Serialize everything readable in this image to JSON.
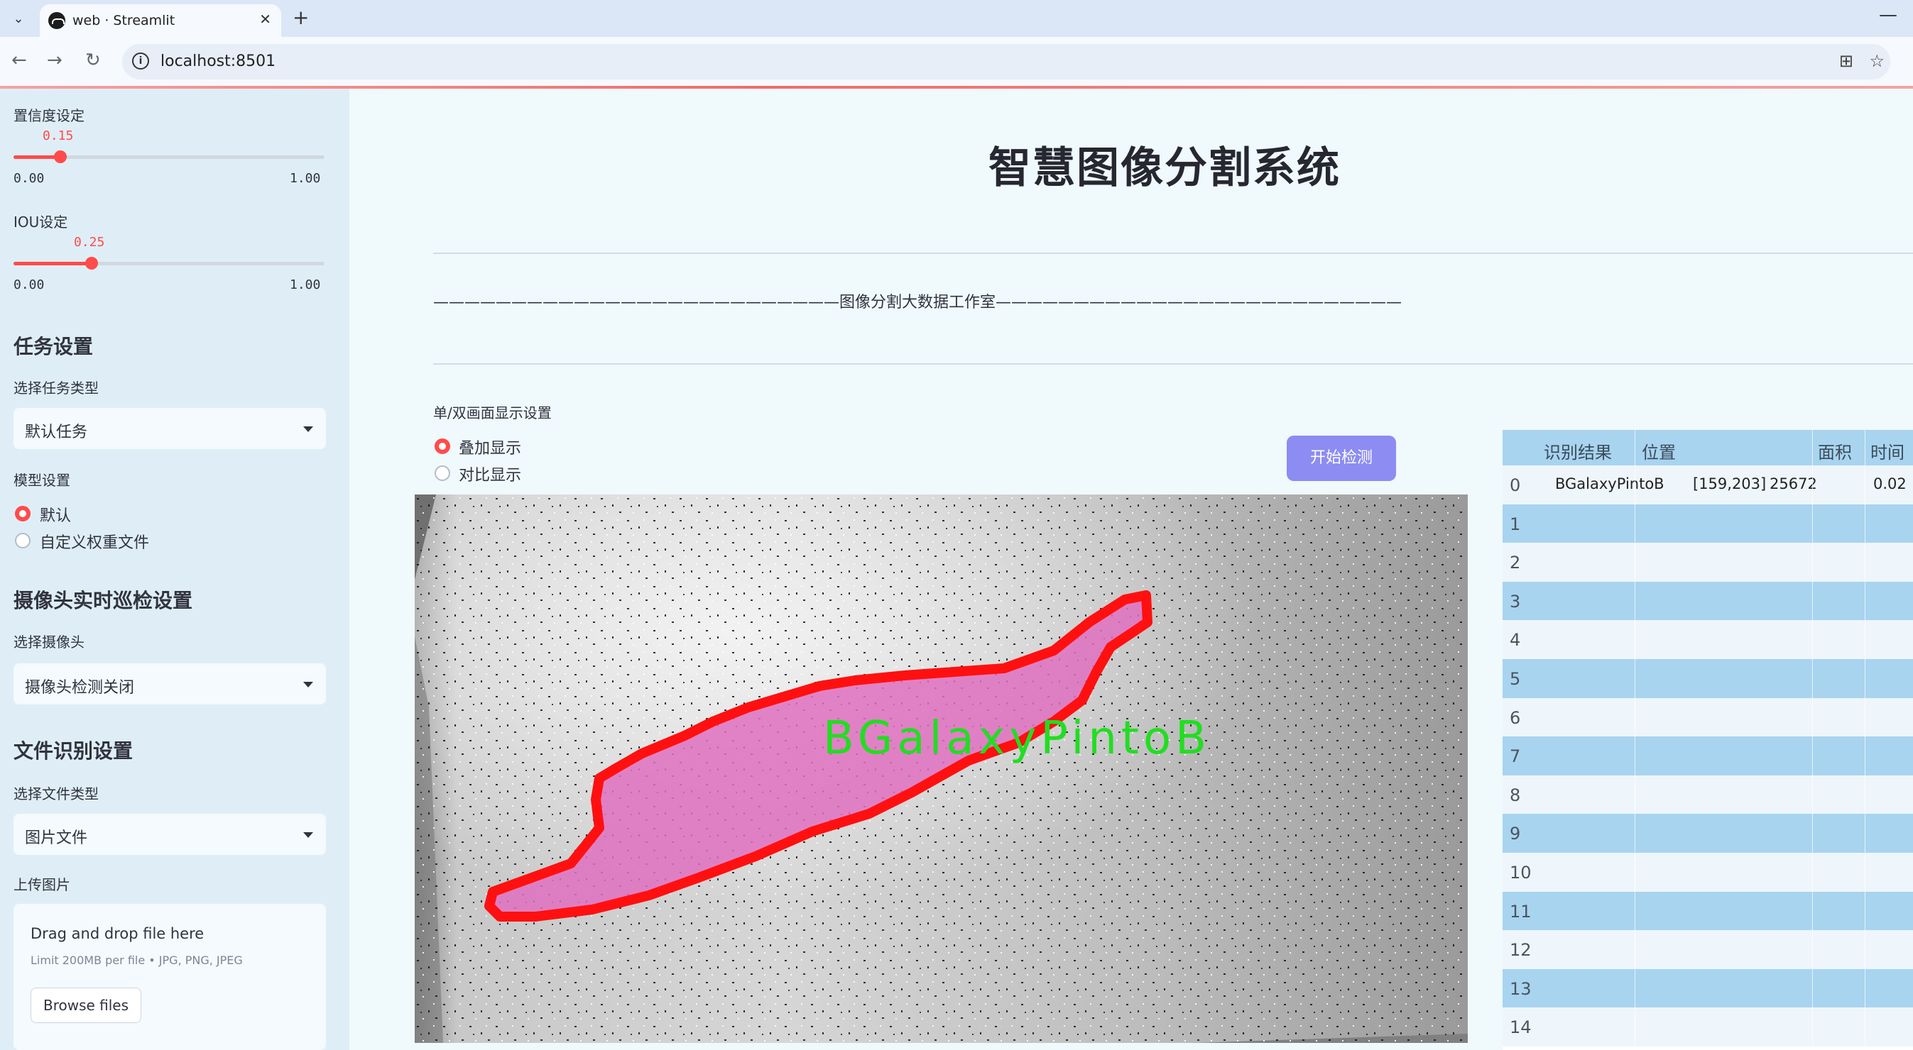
{
  "browser": {
    "tab_title": "web · Streamlit",
    "url": "localhost:8501"
  },
  "sidebar": {
    "confidence": {
      "label": "置信度设定",
      "value": "0.15",
      "min": "0.00",
      "max": "1.00",
      "fraction": 0.15
    },
    "iou": {
      "label": "IOU设定",
      "value": "0.25",
      "min": "0.00",
      "max": "1.00",
      "fraction": 0.25
    },
    "task_section": "任务设置",
    "task_type_label": "选择任务类型",
    "task_type_value": "默认任务",
    "model_label": "模型设置",
    "model_options": [
      "默认",
      "自定义权重文件"
    ],
    "model_selected": 0,
    "camera_section": "摄像头实时巡检设置",
    "camera_label": "选择摄像头",
    "camera_value": "摄像头检测关闭",
    "file_section": "文件识别设置",
    "file_type_label": "选择文件类型",
    "file_type_value": "图片文件",
    "upload_label": "上传图片",
    "upload_title": "Drag and drop file here",
    "upload_sub": "Limit 200MB per file • JPG, PNG, JPEG",
    "browse_button": "Browse files"
  },
  "main": {
    "title": "智慧图像分割系统",
    "banner": "——————————————————————————图像分割大数据工作室——————————————————————————",
    "display_mode_label": "单/双画面显示设置",
    "display_modes": [
      "叠加显示",
      "对比显示"
    ],
    "display_selected": 0,
    "start_button": "开始检测",
    "detection_label": "BGalaxyPintoB"
  },
  "table": {
    "columns": [
      "识别结果",
      "位置",
      "面积",
      "时间"
    ],
    "rows": [
      {
        "id": "0",
        "result": "BGalaxyPintoB",
        "position": "[159,203]",
        "area": "25672",
        "time": "0.02"
      },
      {
        "id": "1"
      },
      {
        "id": "2"
      },
      {
        "id": "3"
      },
      {
        "id": "4"
      },
      {
        "id": "5"
      },
      {
        "id": "6"
      },
      {
        "id": "7"
      },
      {
        "id": "8"
      },
      {
        "id": "9"
      },
      {
        "id": "10"
      },
      {
        "id": "11"
      },
      {
        "id": "12"
      },
      {
        "id": "13"
      },
      {
        "id": "14"
      }
    ]
  },
  "colors": {
    "accent": "#ff4b4b",
    "button": "#8c8cf2",
    "table_header": "#a8d4f0",
    "mask": "#e070c0",
    "contour": "#ff1010",
    "label_green": "#22dd22"
  }
}
